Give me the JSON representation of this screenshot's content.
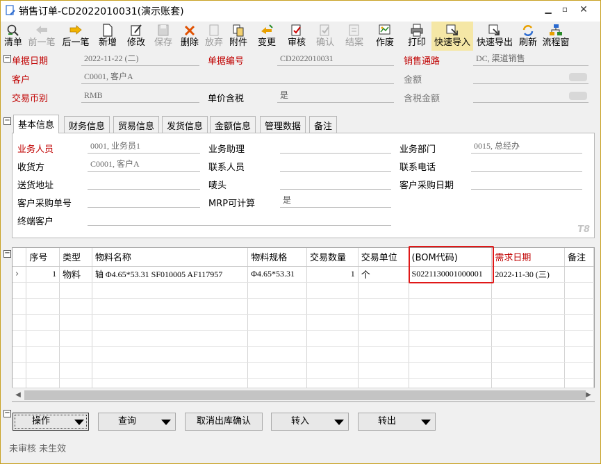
{
  "window": {
    "title": "销售订单-CD2022010031(演示账套)"
  },
  "toolbar": [
    {
      "id": "clear",
      "label": "清单",
      "icon": "magnifier-icon",
      "disabled": false
    },
    {
      "id": "prev",
      "label": "前一笔",
      "icon": "arrow-left-icon",
      "disabled": true
    },
    {
      "id": "next",
      "label": "后一笔",
      "icon": "arrow-right-icon",
      "disabled": false
    },
    {
      "id": "new",
      "label": "新增",
      "icon": "new-doc-icon",
      "disabled": false
    },
    {
      "id": "edit",
      "label": "修改",
      "icon": "edit-icon",
      "disabled": false
    },
    {
      "id": "save",
      "label": "保存",
      "icon": "save-icon",
      "disabled": true
    },
    {
      "id": "delete",
      "label": "删除",
      "icon": "delete-icon",
      "disabled": false
    },
    {
      "id": "discard",
      "label": "放弃",
      "icon": "discard-icon",
      "disabled": true
    },
    {
      "id": "attach",
      "label": "附件",
      "icon": "attachment-icon",
      "disabled": false
    },
    {
      "id": "change",
      "label": "变更",
      "icon": "change-icon",
      "disabled": false
    },
    {
      "id": "audit",
      "label": "审核",
      "icon": "audit-icon",
      "disabled": false
    },
    {
      "id": "confirm",
      "label": "确认",
      "icon": "confirm-icon",
      "disabled": true
    },
    {
      "id": "close",
      "label": "结案",
      "icon": "close-case-icon",
      "disabled": true
    },
    {
      "id": "void",
      "label": "作废",
      "icon": "void-icon",
      "disabled": false
    },
    {
      "id": "print",
      "label": "打印",
      "icon": "printer-icon",
      "disabled": false
    },
    {
      "id": "quick_import",
      "label": "快速导入",
      "icon": "quick-import-icon",
      "disabled": false,
      "active": true
    },
    {
      "id": "quick_export",
      "label": "快速导出",
      "icon": "quick-export-icon",
      "disabled": false
    },
    {
      "id": "refresh",
      "label": "刷新",
      "icon": "refresh-icon",
      "disabled": false
    },
    {
      "id": "workflow",
      "label": "流程窗",
      "icon": "workflow-icon",
      "disabled": false
    }
  ],
  "header": {
    "fields": [
      {
        "label": "单据日期",
        "value": "2022-11-22 (二)",
        "required": true
      },
      {
        "label": "单据编号",
        "value": "CD2022010031",
        "required": true
      },
      {
        "label": "销售通路",
        "value": "DC, 渠道销售",
        "required": true
      },
      {
        "label": "客户",
        "value": "C0001, 客户A",
        "required": true
      },
      {
        "label": "金额",
        "value": "",
        "required": false
      },
      {
        "label": "交易币别",
        "value": "RMB",
        "required": true
      },
      {
        "label": "单价含税",
        "value": "是",
        "required": false
      },
      {
        "label": "含税金额",
        "value": "",
        "required": false
      }
    ]
  },
  "tabs": [
    "基本信息",
    "财务信息",
    "贸易信息",
    "发货信息",
    "金额信息",
    "管理数据",
    "备注"
  ],
  "basic": {
    "fields": [
      {
        "label": "业务人员",
        "value": "0001, 业务员1",
        "required": true
      },
      {
        "label": "业务助理",
        "value": "",
        "required": false
      },
      {
        "label": "业务部门",
        "value": "0015, 总经办",
        "required": false
      },
      {
        "label": "收货方",
        "value": "C0001, 客户A",
        "required": false
      },
      {
        "label": "联系人员",
        "value": "",
        "required": false
      },
      {
        "label": "联系电话",
        "value": "",
        "required": false
      },
      {
        "label": "送货地址",
        "value": "",
        "required": false
      },
      {
        "label": "唛头",
        "value": "",
        "required": false
      },
      {
        "label": "客户采购日期",
        "value": "",
        "required": false
      },
      {
        "label": "客户采购单号",
        "value": "",
        "required": false
      },
      {
        "label": "MRP可计算",
        "value": "是",
        "required": false
      },
      {
        "label": "终端客户",
        "value": "",
        "required": false
      }
    ],
    "watermark": "T8"
  },
  "grid": {
    "columns": [
      "",
      "序号",
      "类型",
      "物料名称",
      "物料规格",
      "交易数量",
      "交易单位",
      "(BOM代码)",
      "需求日期",
      "备注"
    ],
    "rows": [
      {
        "marker": "›",
        "seq": "1",
        "type": "物料",
        "name": "轴 Φ4.65*53.31 SF010005 AF117957",
        "spec": "Φ4.65*53.31",
        "qty": "1",
        "unit": "个",
        "bom": "S0221130001000001",
        "date": "2022-11-30 (三)",
        "note": ""
      }
    ]
  },
  "actions": [
    "操作",
    "查询",
    "取消出库确认",
    "转入",
    "转出"
  ],
  "status": "未审核 未生效"
}
